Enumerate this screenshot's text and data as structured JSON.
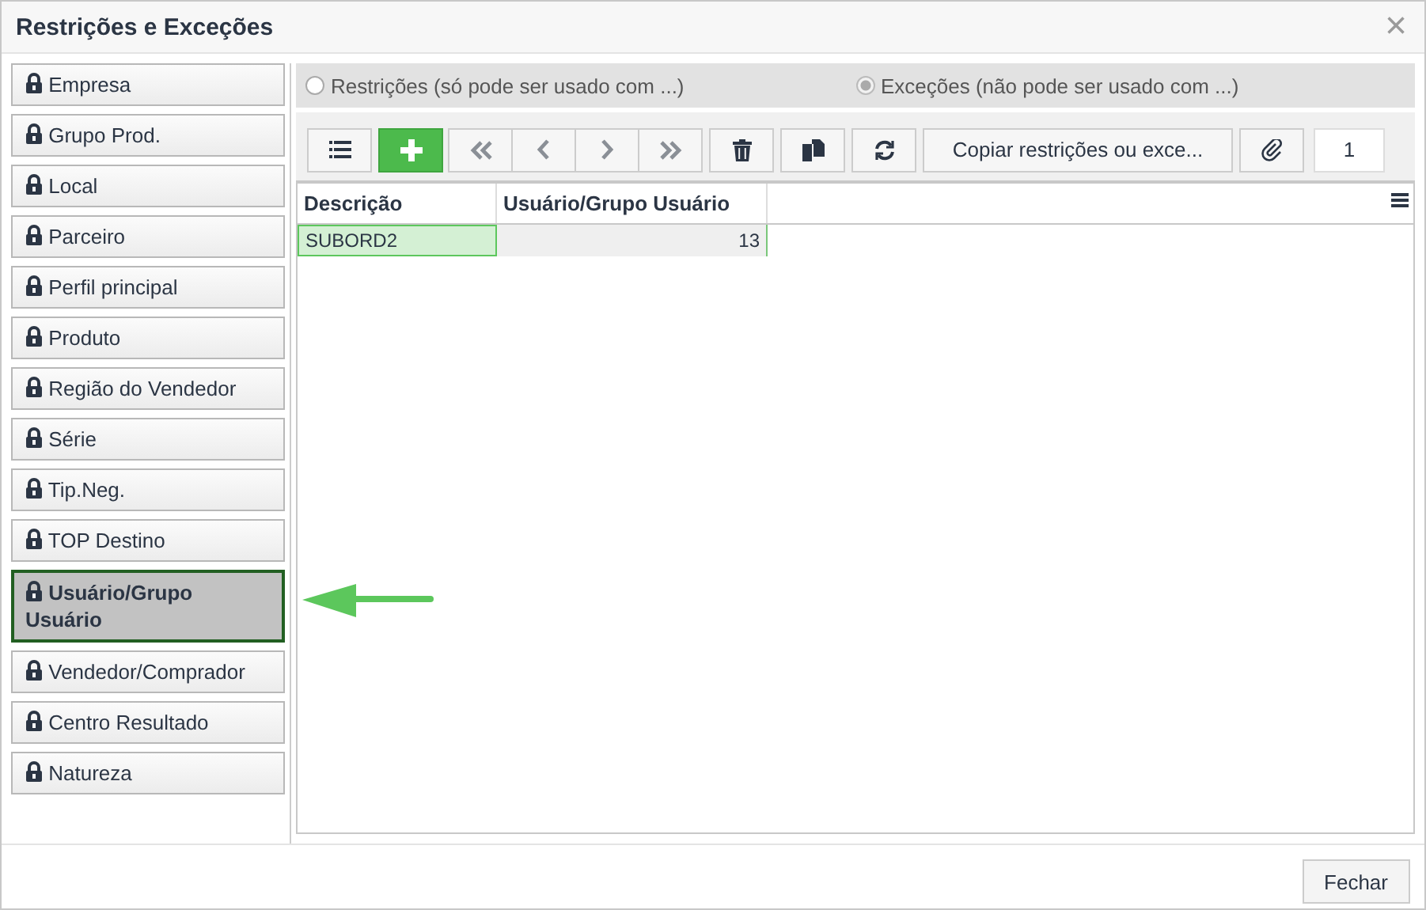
{
  "window": {
    "title": "Restrições e Exceções",
    "close": "×"
  },
  "categories": [
    {
      "label": "Empresa",
      "selected": false
    },
    {
      "label": "Grupo Prod.",
      "selected": false
    },
    {
      "label": "Local",
      "selected": false
    },
    {
      "label": "Parceiro",
      "selected": false
    },
    {
      "label": "Perfil principal",
      "selected": false
    },
    {
      "label": "Produto",
      "selected": false
    },
    {
      "label": "Região do Vendedor",
      "selected": false
    },
    {
      "label": "Série",
      "selected": false
    },
    {
      "label": "Tip.Neg.",
      "selected": false
    },
    {
      "label": "TOP Destino",
      "selected": false
    },
    {
      "label": "Usuário/Grupo Usuário",
      "selected": true
    },
    {
      "label": "Vendedor/Comprador",
      "selected": false
    },
    {
      "label": "Centro Resultado",
      "selected": false
    },
    {
      "label": "Natureza",
      "selected": false
    }
  ],
  "mode_options": [
    {
      "label": "Restrições (só pode ser usado com ...)",
      "selected": false
    },
    {
      "label": "Exceções (não pode ser usado com ...)",
      "selected": true
    }
  ],
  "toolbar": [
    {
      "kind": "list"
    },
    {
      "kind": "add"
    },
    {
      "kind": "first"
    },
    {
      "kind": "prev"
    },
    {
      "kind": "next"
    },
    {
      "kind": "last"
    },
    {
      "kind": "delete"
    },
    {
      "kind": "copy"
    },
    {
      "kind": "refresh"
    },
    {
      "kind": "text",
      "label": "Copiar restrições ou exce..."
    },
    {
      "kind": "attach"
    }
  ],
  "page": "1",
  "table": {
    "columns": [
      "Descrição",
      "Usuário/Grupo Usuário"
    ],
    "rows": [
      {
        "cells": [
          "SUBORD2",
          "13"
        ],
        "selected": true
      }
    ]
  },
  "footer": {
    "button": "Fechar"
  }
}
